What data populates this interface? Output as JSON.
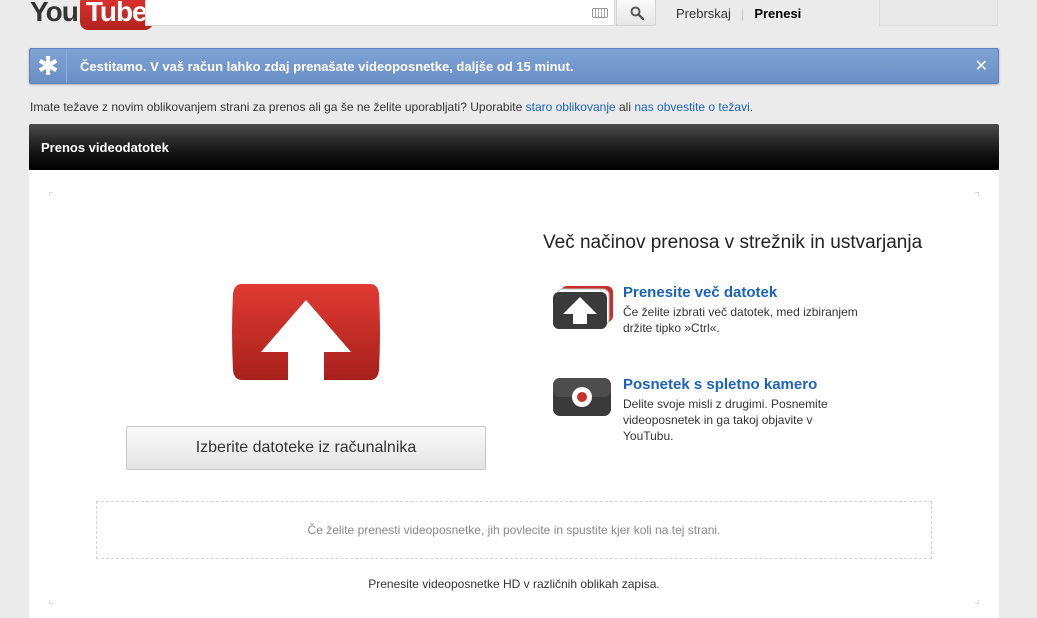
{
  "header": {
    "logo_you": "You",
    "logo_tube": "Tube",
    "search_value": "",
    "nav": {
      "browse": "Prebrskaj",
      "upload": "Prenesi"
    }
  },
  "alert": {
    "message": "Čestitamo. V vaš račun lahko zdaj prenašate videoposnetke, daljše od 15 minut.",
    "close": "✕"
  },
  "info": {
    "text_before": "Imate težave z novim oblikovanjem strani za prenos ali ga še ne želite uporabljati? Uporabite ",
    "link_old": "staro oblikovanje",
    "text_mid": " ali ",
    "link_report": "nas obvestite o težavi",
    "text_after": "."
  },
  "section": {
    "title": "Prenos videodatotek",
    "select_button": "Izberite datoteke iz računalnika",
    "right_title": "Več načinov prenosa v strežnik in ustvarjanja",
    "options": [
      {
        "title": "Prenesite več datotek",
        "desc": "Če želite izbrati več datotek, med izbiranjem držite tipko »Ctrl«."
      },
      {
        "title": "Posnetek s spletno kamero",
        "desc": "Delite svoje misli z drugimi. Posnemite videoposnetek in ga takoj objavite v YouTubu."
      }
    ],
    "drop_zone": "Če želite prenesti videoposnetke, jih povlecite in spustite kjer koli na tej strani.",
    "hd_text": "Prenesite videoposnetke HD v različnih oblikah zapisa."
  },
  "colors": {
    "brand_red": "#c4302b",
    "link_blue": "#1c62b9",
    "alert_blue": "#7fa2d4"
  }
}
